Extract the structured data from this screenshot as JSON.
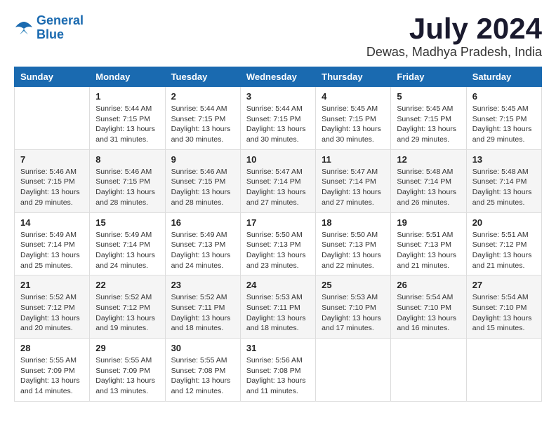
{
  "logo": {
    "line1": "General",
    "line2": "Blue"
  },
  "title": "July 2024",
  "location": "Dewas, Madhya Pradesh, India",
  "weekdays": [
    "Sunday",
    "Monday",
    "Tuesday",
    "Wednesday",
    "Thursday",
    "Friday",
    "Saturday"
  ],
  "weeks": [
    [
      {
        "day": "",
        "info": ""
      },
      {
        "day": "1",
        "info": "Sunrise: 5:44 AM\nSunset: 7:15 PM\nDaylight: 13 hours\nand 31 minutes."
      },
      {
        "day": "2",
        "info": "Sunrise: 5:44 AM\nSunset: 7:15 PM\nDaylight: 13 hours\nand 30 minutes."
      },
      {
        "day": "3",
        "info": "Sunrise: 5:44 AM\nSunset: 7:15 PM\nDaylight: 13 hours\nand 30 minutes."
      },
      {
        "day": "4",
        "info": "Sunrise: 5:45 AM\nSunset: 7:15 PM\nDaylight: 13 hours\nand 30 minutes."
      },
      {
        "day": "5",
        "info": "Sunrise: 5:45 AM\nSunset: 7:15 PM\nDaylight: 13 hours\nand 29 minutes."
      },
      {
        "day": "6",
        "info": "Sunrise: 5:45 AM\nSunset: 7:15 PM\nDaylight: 13 hours\nand 29 minutes."
      }
    ],
    [
      {
        "day": "7",
        "info": "Sunrise: 5:46 AM\nSunset: 7:15 PM\nDaylight: 13 hours\nand 29 minutes."
      },
      {
        "day": "8",
        "info": "Sunrise: 5:46 AM\nSunset: 7:15 PM\nDaylight: 13 hours\nand 28 minutes."
      },
      {
        "day": "9",
        "info": "Sunrise: 5:46 AM\nSunset: 7:15 PM\nDaylight: 13 hours\nand 28 minutes."
      },
      {
        "day": "10",
        "info": "Sunrise: 5:47 AM\nSunset: 7:14 PM\nDaylight: 13 hours\nand 27 minutes."
      },
      {
        "day": "11",
        "info": "Sunrise: 5:47 AM\nSunset: 7:14 PM\nDaylight: 13 hours\nand 27 minutes."
      },
      {
        "day": "12",
        "info": "Sunrise: 5:48 AM\nSunset: 7:14 PM\nDaylight: 13 hours\nand 26 minutes."
      },
      {
        "day": "13",
        "info": "Sunrise: 5:48 AM\nSunset: 7:14 PM\nDaylight: 13 hours\nand 25 minutes."
      }
    ],
    [
      {
        "day": "14",
        "info": "Sunrise: 5:49 AM\nSunset: 7:14 PM\nDaylight: 13 hours\nand 25 minutes."
      },
      {
        "day": "15",
        "info": "Sunrise: 5:49 AM\nSunset: 7:14 PM\nDaylight: 13 hours\nand 24 minutes."
      },
      {
        "day": "16",
        "info": "Sunrise: 5:49 AM\nSunset: 7:13 PM\nDaylight: 13 hours\nand 24 minutes."
      },
      {
        "day": "17",
        "info": "Sunrise: 5:50 AM\nSunset: 7:13 PM\nDaylight: 13 hours\nand 23 minutes."
      },
      {
        "day": "18",
        "info": "Sunrise: 5:50 AM\nSunset: 7:13 PM\nDaylight: 13 hours\nand 22 minutes."
      },
      {
        "day": "19",
        "info": "Sunrise: 5:51 AM\nSunset: 7:13 PM\nDaylight: 13 hours\nand 21 minutes."
      },
      {
        "day": "20",
        "info": "Sunrise: 5:51 AM\nSunset: 7:12 PM\nDaylight: 13 hours\nand 21 minutes."
      }
    ],
    [
      {
        "day": "21",
        "info": "Sunrise: 5:52 AM\nSunset: 7:12 PM\nDaylight: 13 hours\nand 20 minutes."
      },
      {
        "day": "22",
        "info": "Sunrise: 5:52 AM\nSunset: 7:12 PM\nDaylight: 13 hours\nand 19 minutes."
      },
      {
        "day": "23",
        "info": "Sunrise: 5:52 AM\nSunset: 7:11 PM\nDaylight: 13 hours\nand 18 minutes."
      },
      {
        "day": "24",
        "info": "Sunrise: 5:53 AM\nSunset: 7:11 PM\nDaylight: 13 hours\nand 18 minutes."
      },
      {
        "day": "25",
        "info": "Sunrise: 5:53 AM\nSunset: 7:10 PM\nDaylight: 13 hours\nand 17 minutes."
      },
      {
        "day": "26",
        "info": "Sunrise: 5:54 AM\nSunset: 7:10 PM\nDaylight: 13 hours\nand 16 minutes."
      },
      {
        "day": "27",
        "info": "Sunrise: 5:54 AM\nSunset: 7:10 PM\nDaylight: 13 hours\nand 15 minutes."
      }
    ],
    [
      {
        "day": "28",
        "info": "Sunrise: 5:55 AM\nSunset: 7:09 PM\nDaylight: 13 hours\nand 14 minutes."
      },
      {
        "day": "29",
        "info": "Sunrise: 5:55 AM\nSunset: 7:09 PM\nDaylight: 13 hours\nand 13 minutes."
      },
      {
        "day": "30",
        "info": "Sunrise: 5:55 AM\nSunset: 7:08 PM\nDaylight: 13 hours\nand 12 minutes."
      },
      {
        "day": "31",
        "info": "Sunrise: 5:56 AM\nSunset: 7:08 PM\nDaylight: 13 hours\nand 11 minutes."
      },
      {
        "day": "",
        "info": ""
      },
      {
        "day": "",
        "info": ""
      },
      {
        "day": "",
        "info": ""
      }
    ]
  ]
}
